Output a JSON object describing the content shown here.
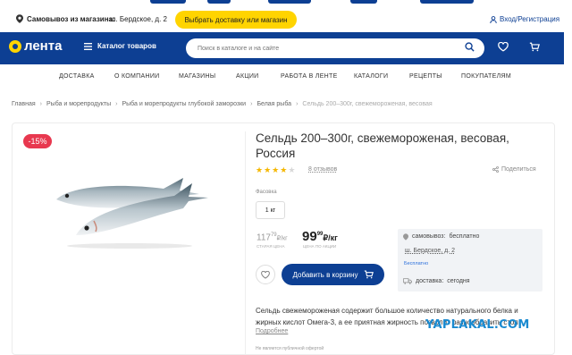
{
  "top_bar": {
    "pickup_label": "Самовывоз из магазина:",
    "pickup_address": "ш. Бердское, д. 2",
    "choose_button": "Выбрать доставку или магазин",
    "login_label": "Вход/Регистрация"
  },
  "header": {
    "logo_text": "лента",
    "catalog_label": "Каталог товаров",
    "search_placeholder": "Поиск в каталоге и на сайте"
  },
  "nav": {
    "items": [
      "ДОСТАВКА",
      "О КОМПАНИИ",
      "МАГАЗИНЫ",
      "АКЦИИ",
      "РАБОТА В ЛЕНТЕ",
      "КАТАЛОГИ",
      "РЕЦЕПТЫ",
      "ПОКУПАТЕЛЯМ"
    ]
  },
  "breadcrumb": {
    "items": [
      "Главная",
      "Рыба и морепродукты",
      "Рыба и морепродукты глубокой заморозки",
      "Белая рыба",
      "Сельдь 200–300г, свежемороженая, весовая"
    ]
  },
  "product": {
    "discount": "-15%",
    "title": "Сельдь 200–300г, свежемороженая, весовая, Россия",
    "rating": 4.5,
    "reviews": "8 отзывов",
    "share": "Поделиться",
    "pack_label": "Фасовка",
    "pack_value": "1 кг",
    "old_price_int": "117",
    "old_price_frac": "79",
    "old_price_unit": "₽/кг",
    "old_price_caption": "СТАРАЯ ЦЕНА",
    "new_price_int": "99",
    "new_price_frac": "99",
    "new_price_unit": "₽/кг",
    "new_price_caption": "ЦЕНА ПО АКЦИИ",
    "add_to_cart": "Добавить в корзину",
    "description": "Сельдь свежемороженая содержит большое количество натурального белка и жирных кислот Омега-3, а ее приятная жирность позволит разнообразить стол",
    "more": "Подробнее",
    "offer_note": "Не является публичной офертой"
  },
  "availability": {
    "pickup_label": "самовывоз:",
    "pickup_value": "бесплатно",
    "address": "ш. Бердское, д. 2",
    "more_stores": "Бесплатно",
    "delivery_label": "доставка:",
    "delivery_value": "сегодня"
  },
  "watermark": "YAPLAKAL.COM",
  "colors": {
    "brand_blue": "#0d3f93",
    "accent_yellow": "#ffd400",
    "discount_red": "#e8384f",
    "star": "#f5b700"
  }
}
